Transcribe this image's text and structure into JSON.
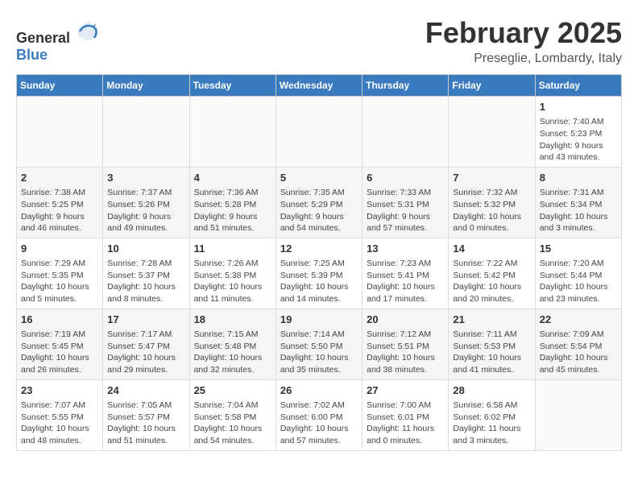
{
  "header": {
    "logo_general": "General",
    "logo_blue": "Blue",
    "month_title": "February 2025",
    "location": "Preseglie, Lombardy, Italy"
  },
  "weekdays": [
    "Sunday",
    "Monday",
    "Tuesday",
    "Wednesday",
    "Thursday",
    "Friday",
    "Saturday"
  ],
  "weeks": [
    [
      {
        "day": "",
        "info": ""
      },
      {
        "day": "",
        "info": ""
      },
      {
        "day": "",
        "info": ""
      },
      {
        "day": "",
        "info": ""
      },
      {
        "day": "",
        "info": ""
      },
      {
        "day": "",
        "info": ""
      },
      {
        "day": "1",
        "info": "Sunrise: 7:40 AM\nSunset: 5:23 PM\nDaylight: 9 hours and 43 minutes."
      }
    ],
    [
      {
        "day": "2",
        "info": "Sunrise: 7:38 AM\nSunset: 5:25 PM\nDaylight: 9 hours and 46 minutes."
      },
      {
        "day": "3",
        "info": "Sunrise: 7:37 AM\nSunset: 5:26 PM\nDaylight: 9 hours and 49 minutes."
      },
      {
        "day": "4",
        "info": "Sunrise: 7:36 AM\nSunset: 5:28 PM\nDaylight: 9 hours and 51 minutes."
      },
      {
        "day": "5",
        "info": "Sunrise: 7:35 AM\nSunset: 5:29 PM\nDaylight: 9 hours and 54 minutes."
      },
      {
        "day": "6",
        "info": "Sunrise: 7:33 AM\nSunset: 5:31 PM\nDaylight: 9 hours and 57 minutes."
      },
      {
        "day": "7",
        "info": "Sunrise: 7:32 AM\nSunset: 5:32 PM\nDaylight: 10 hours and 0 minutes."
      },
      {
        "day": "8",
        "info": "Sunrise: 7:31 AM\nSunset: 5:34 PM\nDaylight: 10 hours and 3 minutes."
      }
    ],
    [
      {
        "day": "9",
        "info": "Sunrise: 7:29 AM\nSunset: 5:35 PM\nDaylight: 10 hours and 5 minutes."
      },
      {
        "day": "10",
        "info": "Sunrise: 7:28 AM\nSunset: 5:37 PM\nDaylight: 10 hours and 8 minutes."
      },
      {
        "day": "11",
        "info": "Sunrise: 7:26 AM\nSunset: 5:38 PM\nDaylight: 10 hours and 11 minutes."
      },
      {
        "day": "12",
        "info": "Sunrise: 7:25 AM\nSunset: 5:39 PM\nDaylight: 10 hours and 14 minutes."
      },
      {
        "day": "13",
        "info": "Sunrise: 7:23 AM\nSunset: 5:41 PM\nDaylight: 10 hours and 17 minutes."
      },
      {
        "day": "14",
        "info": "Sunrise: 7:22 AM\nSunset: 5:42 PM\nDaylight: 10 hours and 20 minutes."
      },
      {
        "day": "15",
        "info": "Sunrise: 7:20 AM\nSunset: 5:44 PM\nDaylight: 10 hours and 23 minutes."
      }
    ],
    [
      {
        "day": "16",
        "info": "Sunrise: 7:19 AM\nSunset: 5:45 PM\nDaylight: 10 hours and 26 minutes."
      },
      {
        "day": "17",
        "info": "Sunrise: 7:17 AM\nSunset: 5:47 PM\nDaylight: 10 hours and 29 minutes."
      },
      {
        "day": "18",
        "info": "Sunrise: 7:15 AM\nSunset: 5:48 PM\nDaylight: 10 hours and 32 minutes."
      },
      {
        "day": "19",
        "info": "Sunrise: 7:14 AM\nSunset: 5:50 PM\nDaylight: 10 hours and 35 minutes."
      },
      {
        "day": "20",
        "info": "Sunrise: 7:12 AM\nSunset: 5:51 PM\nDaylight: 10 hours and 38 minutes."
      },
      {
        "day": "21",
        "info": "Sunrise: 7:11 AM\nSunset: 5:53 PM\nDaylight: 10 hours and 41 minutes."
      },
      {
        "day": "22",
        "info": "Sunrise: 7:09 AM\nSunset: 5:54 PM\nDaylight: 10 hours and 45 minutes."
      }
    ],
    [
      {
        "day": "23",
        "info": "Sunrise: 7:07 AM\nSunset: 5:55 PM\nDaylight: 10 hours and 48 minutes."
      },
      {
        "day": "24",
        "info": "Sunrise: 7:05 AM\nSunset: 5:57 PM\nDaylight: 10 hours and 51 minutes."
      },
      {
        "day": "25",
        "info": "Sunrise: 7:04 AM\nSunset: 5:58 PM\nDaylight: 10 hours and 54 minutes."
      },
      {
        "day": "26",
        "info": "Sunrise: 7:02 AM\nSunset: 6:00 PM\nDaylight: 10 hours and 57 minutes."
      },
      {
        "day": "27",
        "info": "Sunrise: 7:00 AM\nSunset: 6:01 PM\nDaylight: 11 hours and 0 minutes."
      },
      {
        "day": "28",
        "info": "Sunrise: 6:58 AM\nSunset: 6:02 PM\nDaylight: 11 hours and 3 minutes."
      },
      {
        "day": "",
        "info": ""
      }
    ]
  ]
}
